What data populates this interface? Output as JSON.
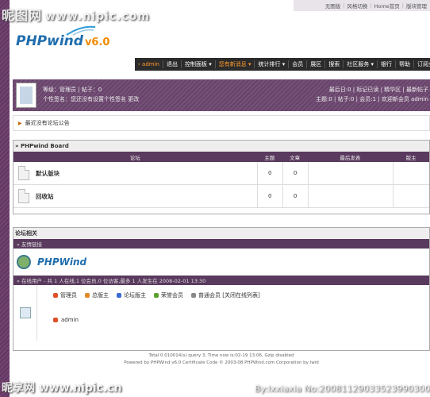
{
  "toplinks": [
    "无图版",
    "风格切换",
    "Home首页",
    "版块管理"
  ],
  "logo": {
    "name": "PHPwind",
    "version": "v6.0"
  },
  "nav": {
    "user": "› admin",
    "items": [
      "退出",
      "控制面板 ▾",
      "您有新消息 ▾",
      "统计排行 ▾",
      "会员",
      "展区",
      "搜索",
      "社区服务 ▾",
      "银行",
      "帮助",
      "订阅全站"
    ],
    "highlight_index": 2
  },
  "userpanel": {
    "line1": "等级：管理员 | 帖子：0",
    "line2": "个性签名：您还没有设置个性签名 更改",
    "stats1": "最后日:0 | 标记已读 | 精华区 | 最新帖子",
    "stats2": "主题:0 | 帖子:0 | 会员:1 | 欢迎新会员 admin"
  },
  "notice": "最近没有论坛公告",
  "board": {
    "title": "» PHPwind Board",
    "headers": [
      "论坛",
      "主题",
      "文章",
      "最后发表",
      "版主"
    ],
    "forums": [
      {
        "name": "默认版块",
        "topics": "0",
        "posts": "0",
        "last": "",
        "mod": ""
      },
      {
        "name": "回收站",
        "topics": "0",
        "posts": "0",
        "last": "",
        "mod": ""
      }
    ]
  },
  "related": {
    "title": "论坛相关",
    "links_head": "» 友情链接",
    "partner_logo": "PHPWind",
    "online_head": "» 在线用户 - 共 1 人在线,1 位会员,0 位访客,最多 1 人发生在 2008-02-01 13:30",
    "legend": [
      {
        "label": "管理员",
        "color": "#e0502a"
      },
      {
        "label": "总版主",
        "color": "#e08a2a"
      },
      {
        "label": "论坛版主",
        "color": "#3a6ad0"
      },
      {
        "label": "荣誉会员",
        "color": "#5aa02a"
      },
      {
        "label": "普通会员 [关闭在线列表]",
        "color": "#888888"
      }
    ],
    "online_user": "admin"
  },
  "footer": {
    "line1": "Total 0.010014(s) query 3, Time now is:02-19 13:06, Gzip disabled",
    "line2": "Powered by PHPWind v6.0 Certificate Code © 2003-08 PHPWind.com Corporation by lwid"
  },
  "watermarks": {
    "top": "昵图网",
    "top_url": "www.nipic.com",
    "bottom": "昵享网 www.nipic.cn",
    "id": "By:lxxiaxia No:20081129033523990300"
  }
}
